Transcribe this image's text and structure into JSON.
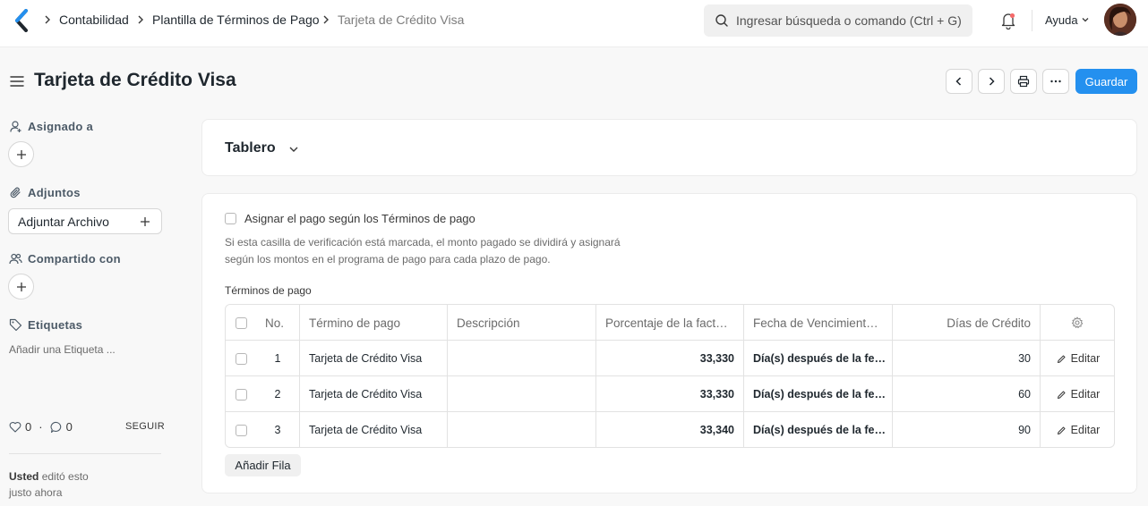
{
  "nav": {
    "breadcrumbs": [
      "Contabilidad",
      "Plantilla de Términos de Pago",
      "Tarjeta de Crédito Visa"
    ],
    "search_placeholder": "Ingresar búsqueda o comando (Ctrl + G)",
    "help_label": "Ayuda"
  },
  "page": {
    "title": "Tarjeta de Crédito Visa",
    "save_label": "Guardar"
  },
  "sidebar": {
    "assigned_label": "Asignado a",
    "attachments_label": "Adjuntos",
    "attach_button": "Adjuntar Archivo",
    "shared_label": "Compartido con",
    "tags_label": "Etiquetas",
    "add_tag": "Añadir una Etiqueta ...",
    "likes_count": "0",
    "comments_count": "0",
    "dot": "·",
    "follow_label": "SEGUIR",
    "edited_by": "Usted",
    "edited_text": "editó esto",
    "edited_when": "justo ahora"
  },
  "dashboard": {
    "title": "Tablero"
  },
  "form": {
    "allocate_label": "Asignar el pago según los Términos de pago",
    "allocate_desc_line1": "Si esta casilla de verificación está marcada, el monto pagado se dividirá y asignará",
    "allocate_desc_line2": "según los montos en el programa de pago para cada plazo de pago.",
    "terms_label": "Términos de pago",
    "columns": [
      "No.",
      "Término de pago",
      "Descripción",
      "Porcentaje de la fact…",
      "Fecha de Vencimient…",
      "Días de Crédito"
    ],
    "rows": [
      {
        "no": "1",
        "term": "Tarjeta de Crédito Visa",
        "description": "",
        "percent": "33,330",
        "due": "Día(s) después de la fe…",
        "days": "30",
        "edit": "Editar"
      },
      {
        "no": "2",
        "term": "Tarjeta de Crédito Visa",
        "description": "",
        "percent": "33,330",
        "due": "Día(s) después de la fe…",
        "days": "60",
        "edit": "Editar"
      },
      {
        "no": "3",
        "term": "Tarjeta de Crédito Visa",
        "description": "",
        "percent": "33,340",
        "due": "Día(s) después de la fe…",
        "days": "90",
        "edit": "Editar"
      }
    ],
    "add_row_label": "Añadir Fila"
  },
  "colors": {
    "primary": "#2490ef",
    "text": "#1f272e",
    "muted": "#6b6b6b"
  }
}
